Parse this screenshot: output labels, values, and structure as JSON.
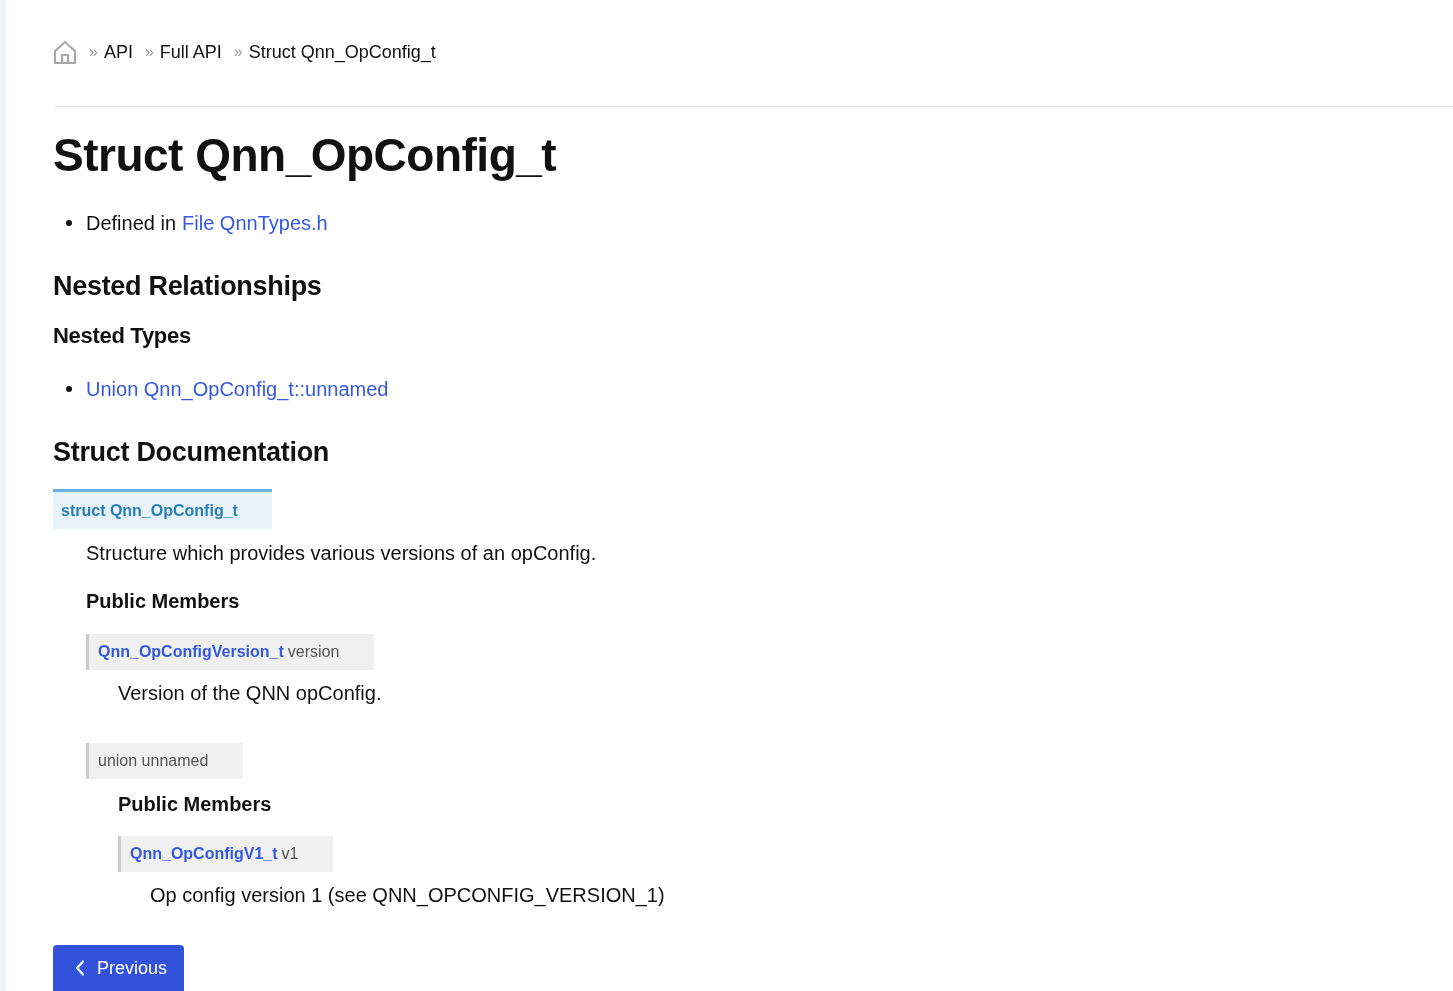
{
  "breadcrumb": [
    {
      "separator": "»",
      "label": "API"
    },
    {
      "separator": "»",
      "label": "Full API"
    },
    {
      "separator": "»",
      "label": "Struct Qnn_OpConfig_t"
    }
  ],
  "title": "Struct Qnn_OpConfig_t",
  "defined_in": {
    "prefix": "Defined in",
    "link": "File QnnTypes.h"
  },
  "nested_relationships": {
    "heading": "Nested Relationships",
    "subheading": "Nested Types",
    "items": [
      "Union Qnn_OpConfig_t::unnamed"
    ]
  },
  "struct_documentation": {
    "heading": "Struct Documentation",
    "signature": "struct Qnn_OpConfig_t",
    "description": "Structure which provides various versions of an opConfig.",
    "members_heading": "Public Members",
    "members": [
      {
        "kind": "typed",
        "type": "Qnn_OpConfigVersion_t",
        "name": "version",
        "description": "Version of the QNN opConfig."
      },
      {
        "kind": "union",
        "signature": "union unnamed",
        "members_heading": "Public Members",
        "members": [
          {
            "kind": "typed",
            "type": "Qnn_OpConfigV1_t",
            "name": "v1",
            "description": "Op config version 1 (see QNN_OPCONFIG_VERSION_1)"
          }
        ]
      }
    ]
  },
  "pagination": {
    "previous": "Previous"
  }
}
